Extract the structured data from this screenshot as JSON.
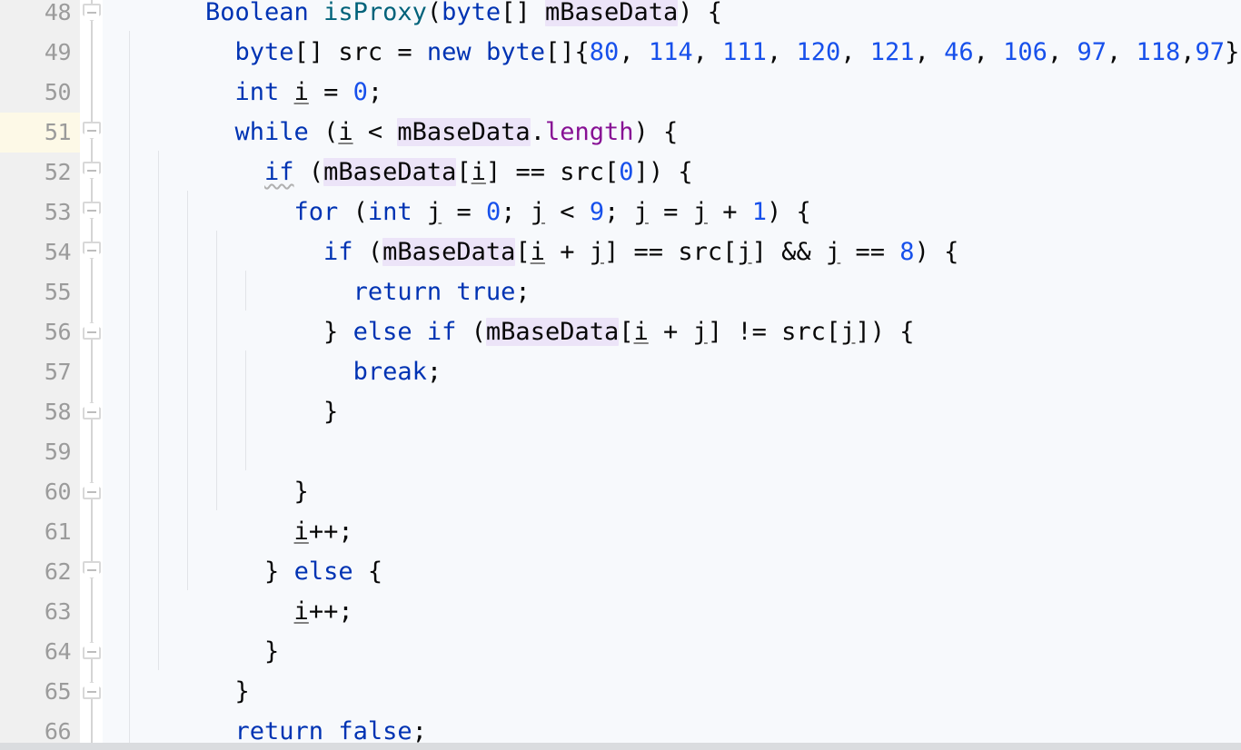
{
  "editor": {
    "language": "java",
    "first_line": 48,
    "last_line": 66,
    "current_line": 51,
    "colors": {
      "background": "#f7f9fc",
      "gutter_background": "#f0f0f0",
      "line_number": "#9b9b9b",
      "current_line_highlight": "#fdf9e7",
      "keyword": "#0033b3",
      "number": "#1750eb",
      "method": "#00627a",
      "field": "#871094",
      "identifier_occurrence_highlight": "#ece4f8",
      "indent_guide": "#e2e4e8",
      "fold_marker_border": "#d8d8d8"
    }
  },
  "gutter": {
    "line_numbers": [
      "48",
      "49",
      "50",
      "51",
      "52",
      "53",
      "54",
      "55",
      "56",
      "57",
      "58",
      "59",
      "60",
      "61",
      "62",
      "63",
      "64",
      "65",
      "66"
    ],
    "fold_markers": [
      {
        "line": 48,
        "type": "start",
        "icon": "fold-collapse-icon"
      },
      {
        "line": 51,
        "type": "start",
        "icon": "fold-collapse-icon"
      },
      {
        "line": 52,
        "type": "start",
        "icon": "fold-collapse-icon"
      },
      {
        "line": 53,
        "type": "start",
        "icon": "fold-collapse-icon"
      },
      {
        "line": 54,
        "type": "start",
        "icon": "fold-collapse-icon"
      },
      {
        "line": 56,
        "type": "end",
        "icon": "fold-end-icon"
      },
      {
        "line": 58,
        "type": "end",
        "icon": "fold-end-icon"
      },
      {
        "line": 60,
        "type": "end",
        "icon": "fold-end-icon"
      },
      {
        "line": 62,
        "type": "start",
        "icon": "fold-collapse-icon"
      },
      {
        "line": 64,
        "type": "end",
        "icon": "fold-end-icon"
      },
      {
        "line": 65,
        "type": "end",
        "icon": "fold-end-icon"
      }
    ]
  },
  "code": {
    "lines": [
      {
        "n": "48",
        "text": "Boolean isProxy(byte[] mBaseData) {"
      },
      {
        "n": "49",
        "text": "  byte[] src = new byte[]{80, 114, 111, 120, 121, 46, 106, 97, 118,97};"
      },
      {
        "n": "50",
        "text": "  int i = 0;"
      },
      {
        "n": "51",
        "text": "  while (i < mBaseData.length) {"
      },
      {
        "n": "52",
        "text": "    if (mBaseData[i] == src[0]) {"
      },
      {
        "n": "53",
        "text": "      for (int j = 0; j < 9; j = j + 1) {"
      },
      {
        "n": "54",
        "text": "        if (mBaseData[i + j] == src[j] && j == 8) {"
      },
      {
        "n": "55",
        "text": "          return true;"
      },
      {
        "n": "56",
        "text": "        } else if (mBaseData[i + j] != src[j]) {"
      },
      {
        "n": "57",
        "text": "          break;"
      },
      {
        "n": "58",
        "text": "        }"
      },
      {
        "n": "59",
        "text": ""
      },
      {
        "n": "60",
        "text": "      }"
      },
      {
        "n": "61",
        "text": "      i++;"
      },
      {
        "n": "62",
        "text": "    } else {"
      },
      {
        "n": "63",
        "text": "      i++;"
      },
      {
        "n": "64",
        "text": "    }"
      },
      {
        "n": "65",
        "text": "  }"
      },
      {
        "n": "66",
        "text": "  return false;"
      }
    ],
    "identifiers_highlighted": [
      "mBaseData"
    ],
    "warning_tokens": [
      {
        "line": "52",
        "token": "if"
      }
    ]
  }
}
